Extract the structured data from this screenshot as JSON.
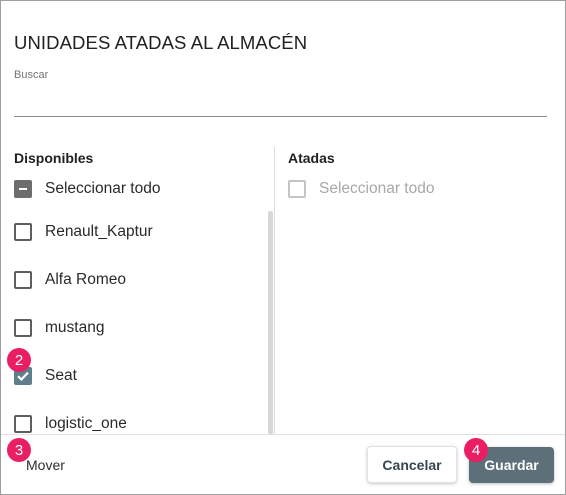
{
  "dialog": {
    "title": "UNIDADES ATADAS AL ALMACÉN",
    "search": {
      "label": "Buscar",
      "value": ""
    }
  },
  "available": {
    "header": "Disponibles",
    "select_all": {
      "label": "Seleccionar todo",
      "state": "indeterminate"
    },
    "items": [
      {
        "label": "Renault_Kaptur",
        "checked": false
      },
      {
        "label": "Alfa Romeo",
        "checked": false
      },
      {
        "label": "mustang",
        "checked": false
      },
      {
        "label": "Seat",
        "checked": true
      },
      {
        "label": "logistic_one",
        "checked": false
      }
    ]
  },
  "attached": {
    "header": "Atadas",
    "select_all": {
      "label": "Seleccionar todo",
      "state": "disabled"
    }
  },
  "footer": {
    "move_label": "Mover",
    "cancel_label": "Cancelar",
    "save_label": "Guardar"
  },
  "badges": {
    "seat": "2",
    "move": "3",
    "save": "4"
  },
  "colors": {
    "badge": "#e91e63",
    "checkbox_checked": "#607d8b",
    "save_button": "#5d7079"
  }
}
